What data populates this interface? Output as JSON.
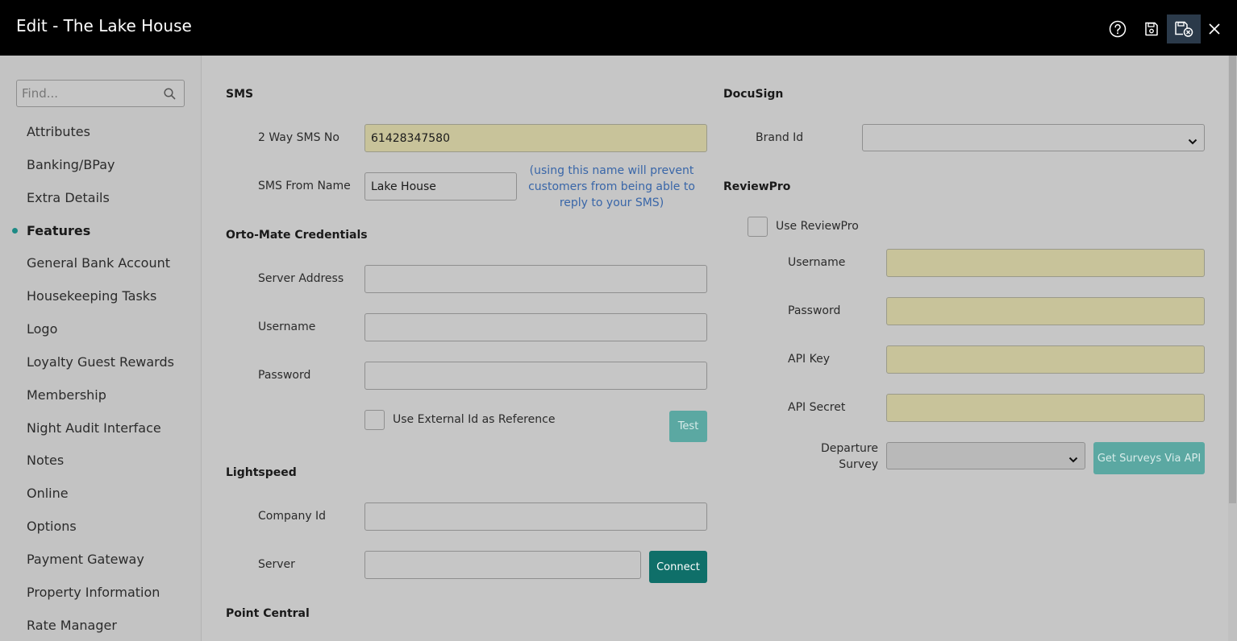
{
  "window": {
    "title": "Edit - The Lake House"
  },
  "toolbar": {
    "help_icon": "question-circle-icon",
    "save_icon": "save-icon",
    "save_close_icon": "save-close-icon",
    "close_icon": "close-icon"
  },
  "sidebar": {
    "search_placeholder": "Find...",
    "items": [
      {
        "label": "Attributes"
      },
      {
        "label": "Banking/BPay"
      },
      {
        "label": "Extra Details"
      },
      {
        "label": "Features",
        "active": true
      },
      {
        "label": "General Bank Account"
      },
      {
        "label": "Housekeeping Tasks"
      },
      {
        "label": "Logo"
      },
      {
        "label": "Loyalty Guest Rewards"
      },
      {
        "label": "Membership"
      },
      {
        "label": "Night Audit Interface"
      },
      {
        "label": "Notes"
      },
      {
        "label": "Online"
      },
      {
        "label": "Options"
      },
      {
        "label": "Payment Gateway"
      },
      {
        "label": "Property Information"
      },
      {
        "label": "Rate Manager"
      }
    ]
  },
  "sms": {
    "title": "SMS",
    "two_way_label": "2 Way SMS No",
    "two_way_value": "61428347580",
    "from_name_label": "SMS From Name",
    "from_name_value": "Lake House",
    "note_line1": "(using this name will prevent",
    "note_line2": "customers from being able to",
    "note_line3": "reply to your SMS)"
  },
  "orto": {
    "title": "Orto-Mate Credentials",
    "server_label": "Server Address",
    "server_value": "",
    "username_label": "Username",
    "username_value": "",
    "password_label": "Password",
    "password_value": "",
    "external_id_label": "Use External Id as Reference",
    "external_id_checked": false,
    "test_button": "Test"
  },
  "lightspeed": {
    "title": "Lightspeed",
    "company_label": "Company Id",
    "company_value": "",
    "server_label": "Server",
    "server_value": "",
    "connect_button": "Connect"
  },
  "point_central": {
    "title": "Point Central"
  },
  "docusign": {
    "title": "DocuSign",
    "brand_label": "Brand Id",
    "brand_value": ""
  },
  "reviewpro": {
    "title": "ReviewPro",
    "use_label": "Use ReviewPro",
    "use_checked": false,
    "username_label": "Username",
    "password_label": "Password",
    "api_key_label": "API Key",
    "api_secret_label": "API Secret",
    "departure_label_line1": "Departure",
    "departure_label_line2": "Survey",
    "departure_value": "",
    "surveys_button": "Get Surveys Via API"
  },
  "colors": {
    "titlebar": "#000000",
    "accent_teal": "#0f6f69",
    "highlight_field": "#c8c39a",
    "note_text": "#3966a8"
  }
}
